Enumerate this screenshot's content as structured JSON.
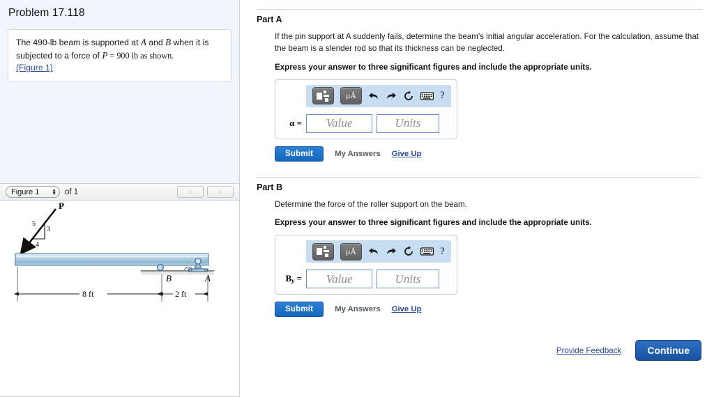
{
  "problem": {
    "title": "Problem 17.118",
    "statement_pre": "The 490-lb beam is supported at ",
    "statement_varA": "A",
    "statement_mid": " and ",
    "statement_varB": "B",
    "statement_post": " when it is subjected to a force of ",
    "statement_varP": "P",
    "statement_eq": " = 900 lb as shown.",
    "figure_link": "(Figure 1)"
  },
  "figure_bar": {
    "selected": "Figure 1",
    "of_text": "of 1",
    "prev_icon": "chevron-left-icon",
    "next_icon": "chevron-right-icon",
    "prev_label": "‹",
    "next_label": "›"
  },
  "figure": {
    "force_label": "P",
    "slope_hyp": "5",
    "slope_vert": "3",
    "slope_horiz": "4",
    "support_B": "B",
    "support_A": "A",
    "dim_left": "8 ft",
    "dim_right": "2 ft",
    "beam_color": "#9dc3dd",
    "beam_edge": "#5a7f99"
  },
  "parts": [
    {
      "heading": "Part A",
      "question": "If the pin support at A suddenly fails, determine the beam's initial angular acceleration. For the calculation, assume that the beam is a slender rod so that its thickness can be neglected.",
      "instruction": "Express your answer to three significant figures and include the appropriate units.",
      "var_label": "α",
      "var_sub": "",
      "value_placeholder": "Value",
      "units_placeholder": "Units",
      "submit_label": "Submit",
      "my_answers_label": "My Answers",
      "give_up_label": "Give Up"
    },
    {
      "heading": "Part B",
      "question": "Determine the force of the roller support on the beam.",
      "instruction": "Express your answer to three significant figures and include the appropriate units.",
      "var_label": "B",
      "var_sub": "y",
      "value_placeholder": "Value",
      "units_placeholder": "Units",
      "submit_label": "Submit",
      "my_answers_label": "My Answers",
      "give_up_label": "Give Up"
    }
  ],
  "toolbar": {
    "template_icon": "math-template-icon",
    "units_icon": "micro-angstrom-units-icon",
    "units_label": "μÅ",
    "undo_icon": "undo-arrow-icon",
    "redo_icon": "redo-arrow-icon",
    "reset_icon": "reset-circular-arrow-icon",
    "keyboard_icon": "keyboard-icon",
    "help_icon": "help-question-icon",
    "help_label": "?"
  },
  "footer": {
    "feedback_label": "Provide Feedback",
    "continue_label": "Continue"
  },
  "colors": {
    "accent_blue": "#2b4b9b",
    "submit_blue": "#1667be",
    "toolbar_blue": "#c6ddf2",
    "panel_bg": "#f1f6fd"
  }
}
